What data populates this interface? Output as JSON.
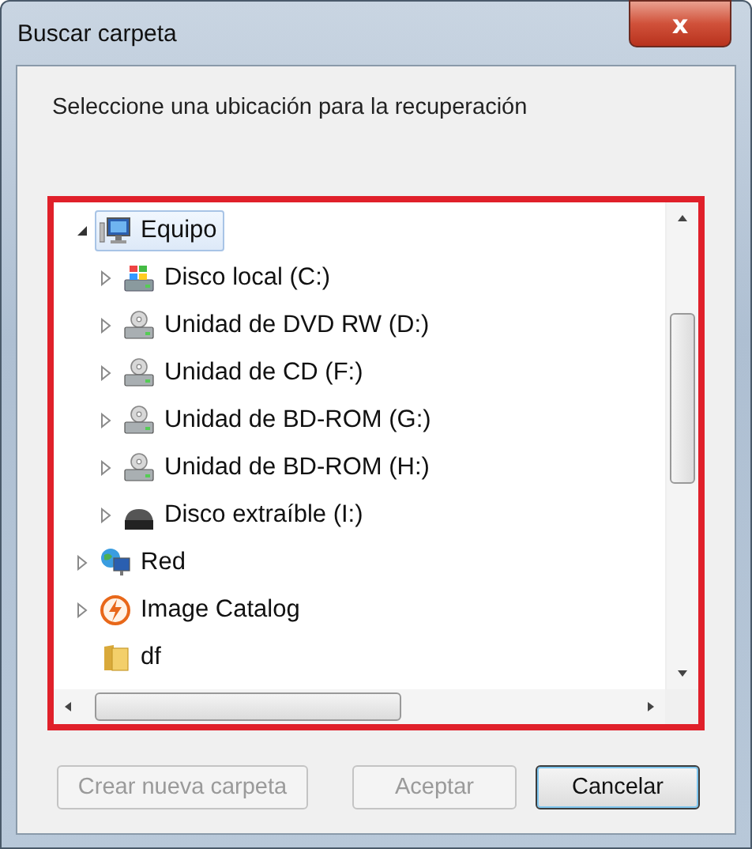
{
  "window": {
    "title": "Buscar carpeta",
    "close": "x"
  },
  "instruction": "Seleccione una ubicación para la recuperación",
  "tree": [
    {
      "label": "Equipo",
      "kind": "computer",
      "expanded": true,
      "selected": true,
      "children": [
        {
          "label": "Disco local (C:)",
          "kind": "system-disk",
          "expanded": false,
          "selected": false
        },
        {
          "label": "Unidad de DVD RW (D:)",
          "kind": "optical",
          "expanded": false,
          "selected": false
        },
        {
          "label": "Unidad de CD (F:)",
          "kind": "optical",
          "expanded": false,
          "selected": false
        },
        {
          "label": "Unidad de BD-ROM (G:)",
          "kind": "optical",
          "expanded": false,
          "selected": false
        },
        {
          "label": "Unidad de BD-ROM (H:)",
          "kind": "optical",
          "expanded": false,
          "selected": false
        },
        {
          "label": "Disco extraíble (I:)",
          "kind": "removable",
          "expanded": false,
          "selected": false
        }
      ]
    },
    {
      "label": "Red",
      "kind": "network",
      "expanded": false,
      "selected": false
    },
    {
      "label": "Image Catalog",
      "kind": "app",
      "expanded": false,
      "selected": false
    },
    {
      "label": "df",
      "kind": "folder",
      "selected": false
    }
  ],
  "buttons": [
    {
      "label": "Crear nueva carpeta",
      "disabled": true,
      "default": false
    },
    {
      "label": "Aceptar",
      "disabled": true,
      "default": false
    },
    {
      "label": "Cancelar",
      "disabled": false,
      "default": true
    }
  ]
}
